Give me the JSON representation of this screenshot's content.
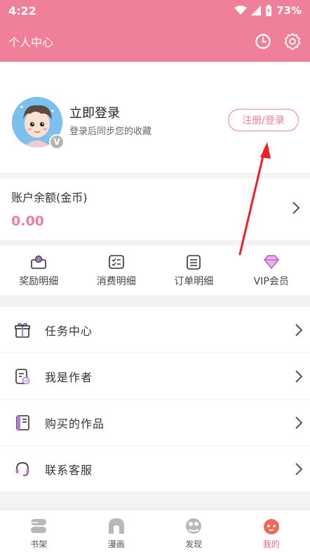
{
  "statusbar": {
    "time": "4:22",
    "battery": "73%"
  },
  "header": {
    "title": "个人中心"
  },
  "profile": {
    "login_title": "立即登录",
    "login_sub": "登录后同步您的收藏",
    "register_button": "注册/登录",
    "badge": "V"
  },
  "balance": {
    "label": "账户余额(金币)",
    "value": "0.00"
  },
  "quick": [
    {
      "label": "奖励明细"
    },
    {
      "label": "消费明细"
    },
    {
      "label": "订单明细"
    },
    {
      "label": "VIP会员"
    }
  ],
  "menu": [
    {
      "label": "任务中心"
    },
    {
      "label": "我是作者"
    },
    {
      "label": "购买的作品"
    },
    {
      "label": "联系客服"
    }
  ],
  "tabbar": [
    {
      "label": "书架"
    },
    {
      "label": "漫画"
    },
    {
      "label": "发现"
    },
    {
      "label": "我的"
    }
  ],
  "colors": {
    "accent": "#f07f9a",
    "balance": "#ef7f9a",
    "active_tab": "#ef6a82",
    "annotation_arrow": "#f0202a"
  }
}
